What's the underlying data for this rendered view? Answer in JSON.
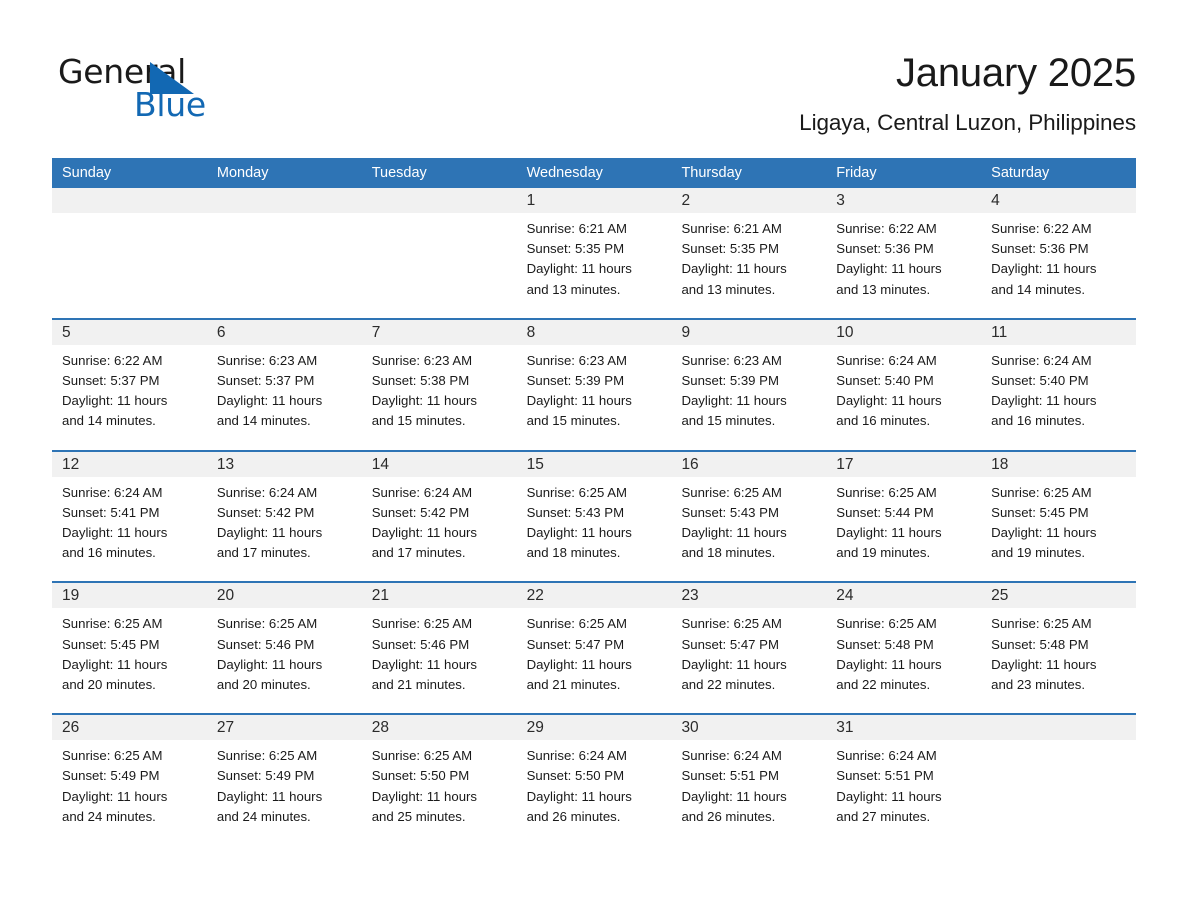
{
  "brand": {
    "name_part1": "General",
    "name_part2": "Blue",
    "triangle_icon": "triangle-icon",
    "accent_color": "#1268b3"
  },
  "header": {
    "title": "January 2025",
    "subtitle": "Ligaya, Central Luzon, Philippines"
  },
  "calendar": {
    "header_color": "#2e74b5",
    "date_band_color": "#f1f1f1",
    "weekdays": [
      "Sunday",
      "Monday",
      "Tuesday",
      "Wednesday",
      "Thursday",
      "Friday",
      "Saturday"
    ],
    "weeks": [
      [
        {
          "day": "",
          "sunrise": "",
          "sunset": "",
          "daylight_line1": "",
          "daylight_line2": ""
        },
        {
          "day": "",
          "sunrise": "",
          "sunset": "",
          "daylight_line1": "",
          "daylight_line2": ""
        },
        {
          "day": "",
          "sunrise": "",
          "sunset": "",
          "daylight_line1": "",
          "daylight_line2": ""
        },
        {
          "day": "1",
          "sunrise": "Sunrise: 6:21 AM",
          "sunset": "Sunset: 5:35 PM",
          "daylight_line1": "Daylight: 11 hours",
          "daylight_line2": "and 13 minutes."
        },
        {
          "day": "2",
          "sunrise": "Sunrise: 6:21 AM",
          "sunset": "Sunset: 5:35 PM",
          "daylight_line1": "Daylight: 11 hours",
          "daylight_line2": "and 13 minutes."
        },
        {
          "day": "3",
          "sunrise": "Sunrise: 6:22 AM",
          "sunset": "Sunset: 5:36 PM",
          "daylight_line1": "Daylight: 11 hours",
          "daylight_line2": "and 13 minutes."
        },
        {
          "day": "4",
          "sunrise": "Sunrise: 6:22 AM",
          "sunset": "Sunset: 5:36 PM",
          "daylight_line1": "Daylight: 11 hours",
          "daylight_line2": "and 14 minutes."
        }
      ],
      [
        {
          "day": "5",
          "sunrise": "Sunrise: 6:22 AM",
          "sunset": "Sunset: 5:37 PM",
          "daylight_line1": "Daylight: 11 hours",
          "daylight_line2": "and 14 minutes."
        },
        {
          "day": "6",
          "sunrise": "Sunrise: 6:23 AM",
          "sunset": "Sunset: 5:37 PM",
          "daylight_line1": "Daylight: 11 hours",
          "daylight_line2": "and 14 minutes."
        },
        {
          "day": "7",
          "sunrise": "Sunrise: 6:23 AM",
          "sunset": "Sunset: 5:38 PM",
          "daylight_line1": "Daylight: 11 hours",
          "daylight_line2": "and 15 minutes."
        },
        {
          "day": "8",
          "sunrise": "Sunrise: 6:23 AM",
          "sunset": "Sunset: 5:39 PM",
          "daylight_line1": "Daylight: 11 hours",
          "daylight_line2": "and 15 minutes."
        },
        {
          "day": "9",
          "sunrise": "Sunrise: 6:23 AM",
          "sunset": "Sunset: 5:39 PM",
          "daylight_line1": "Daylight: 11 hours",
          "daylight_line2": "and 15 minutes."
        },
        {
          "day": "10",
          "sunrise": "Sunrise: 6:24 AM",
          "sunset": "Sunset: 5:40 PM",
          "daylight_line1": "Daylight: 11 hours",
          "daylight_line2": "and 16 minutes."
        },
        {
          "day": "11",
          "sunrise": "Sunrise: 6:24 AM",
          "sunset": "Sunset: 5:40 PM",
          "daylight_line1": "Daylight: 11 hours",
          "daylight_line2": "and 16 minutes."
        }
      ],
      [
        {
          "day": "12",
          "sunrise": "Sunrise: 6:24 AM",
          "sunset": "Sunset: 5:41 PM",
          "daylight_line1": "Daylight: 11 hours",
          "daylight_line2": "and 16 minutes."
        },
        {
          "day": "13",
          "sunrise": "Sunrise: 6:24 AM",
          "sunset": "Sunset: 5:42 PM",
          "daylight_line1": "Daylight: 11 hours",
          "daylight_line2": "and 17 minutes."
        },
        {
          "day": "14",
          "sunrise": "Sunrise: 6:24 AM",
          "sunset": "Sunset: 5:42 PM",
          "daylight_line1": "Daylight: 11 hours",
          "daylight_line2": "and 17 minutes."
        },
        {
          "day": "15",
          "sunrise": "Sunrise: 6:25 AM",
          "sunset": "Sunset: 5:43 PM",
          "daylight_line1": "Daylight: 11 hours",
          "daylight_line2": "and 18 minutes."
        },
        {
          "day": "16",
          "sunrise": "Sunrise: 6:25 AM",
          "sunset": "Sunset: 5:43 PM",
          "daylight_line1": "Daylight: 11 hours",
          "daylight_line2": "and 18 minutes."
        },
        {
          "day": "17",
          "sunrise": "Sunrise: 6:25 AM",
          "sunset": "Sunset: 5:44 PM",
          "daylight_line1": "Daylight: 11 hours",
          "daylight_line2": "and 19 minutes."
        },
        {
          "day": "18",
          "sunrise": "Sunrise: 6:25 AM",
          "sunset": "Sunset: 5:45 PM",
          "daylight_line1": "Daylight: 11 hours",
          "daylight_line2": "and 19 minutes."
        }
      ],
      [
        {
          "day": "19",
          "sunrise": "Sunrise: 6:25 AM",
          "sunset": "Sunset: 5:45 PM",
          "daylight_line1": "Daylight: 11 hours",
          "daylight_line2": "and 20 minutes."
        },
        {
          "day": "20",
          "sunrise": "Sunrise: 6:25 AM",
          "sunset": "Sunset: 5:46 PM",
          "daylight_line1": "Daylight: 11 hours",
          "daylight_line2": "and 20 minutes."
        },
        {
          "day": "21",
          "sunrise": "Sunrise: 6:25 AM",
          "sunset": "Sunset: 5:46 PM",
          "daylight_line1": "Daylight: 11 hours",
          "daylight_line2": "and 21 minutes."
        },
        {
          "day": "22",
          "sunrise": "Sunrise: 6:25 AM",
          "sunset": "Sunset: 5:47 PM",
          "daylight_line1": "Daylight: 11 hours",
          "daylight_line2": "and 21 minutes."
        },
        {
          "day": "23",
          "sunrise": "Sunrise: 6:25 AM",
          "sunset": "Sunset: 5:47 PM",
          "daylight_line1": "Daylight: 11 hours",
          "daylight_line2": "and 22 minutes."
        },
        {
          "day": "24",
          "sunrise": "Sunrise: 6:25 AM",
          "sunset": "Sunset: 5:48 PM",
          "daylight_line1": "Daylight: 11 hours",
          "daylight_line2": "and 22 minutes."
        },
        {
          "day": "25",
          "sunrise": "Sunrise: 6:25 AM",
          "sunset": "Sunset: 5:48 PM",
          "daylight_line1": "Daylight: 11 hours",
          "daylight_line2": "and 23 minutes."
        }
      ],
      [
        {
          "day": "26",
          "sunrise": "Sunrise: 6:25 AM",
          "sunset": "Sunset: 5:49 PM",
          "daylight_line1": "Daylight: 11 hours",
          "daylight_line2": "and 24 minutes."
        },
        {
          "day": "27",
          "sunrise": "Sunrise: 6:25 AM",
          "sunset": "Sunset: 5:49 PM",
          "daylight_line1": "Daylight: 11 hours",
          "daylight_line2": "and 24 minutes."
        },
        {
          "day": "28",
          "sunrise": "Sunrise: 6:25 AM",
          "sunset": "Sunset: 5:50 PM",
          "daylight_line1": "Daylight: 11 hours",
          "daylight_line2": "and 25 minutes."
        },
        {
          "day": "29",
          "sunrise": "Sunrise: 6:24 AM",
          "sunset": "Sunset: 5:50 PM",
          "daylight_line1": "Daylight: 11 hours",
          "daylight_line2": "and 26 minutes."
        },
        {
          "day": "30",
          "sunrise": "Sunrise: 6:24 AM",
          "sunset": "Sunset: 5:51 PM",
          "daylight_line1": "Daylight: 11 hours",
          "daylight_line2": "and 26 minutes."
        },
        {
          "day": "31",
          "sunrise": "Sunrise: 6:24 AM",
          "sunset": "Sunset: 5:51 PM",
          "daylight_line1": "Daylight: 11 hours",
          "daylight_line2": "and 27 minutes."
        },
        {
          "day": "",
          "sunrise": "",
          "sunset": "",
          "daylight_line1": "",
          "daylight_line2": ""
        }
      ]
    ]
  }
}
